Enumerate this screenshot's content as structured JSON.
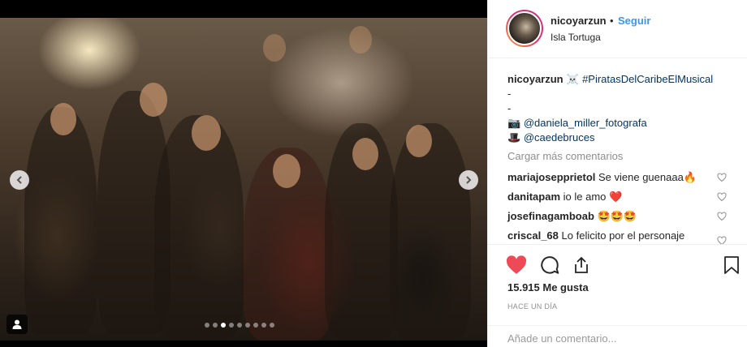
{
  "post": {
    "username": "nicoyarzun",
    "separator": "•",
    "follow_label": "Seguir",
    "location": "Isla Tortuga",
    "image_alt": "",
    "carousel_dots": 9,
    "carousel_active": 2
  },
  "caption": {
    "user": "nicoyarzun",
    "emoji": "☠️",
    "hashtag": "#PiratasDelCaribeElMusical",
    "dash1": "-",
    "dash2": "-",
    "camera_emoji": "📷",
    "mention1": "@daniela_miller_fotografa",
    "hat_emoji": "🎩",
    "mention2": "@caedebruces"
  },
  "load_more_label": "Cargar más comentarios",
  "comments": [
    {
      "user": "mariajosepprietol",
      "text": "Se viene guenaaa🔥"
    },
    {
      "user": "danitapam",
      "text": "io le amo ❤️"
    },
    {
      "user": "josefinagamboab",
      "text": "🤩🤩🤩"
    },
    {
      "user": "criscal_68",
      "text": "Lo felicito por el personaje"
    }
  ],
  "likes": "15.915 Me gusta",
  "time_ago": "HACE UN DÍA",
  "add_comment_placeholder": "Añade un comentario...",
  "colors": {
    "link_blue": "#3897f0",
    "hashtag_blue": "#003569",
    "like_red": "#ed4956",
    "muted_gray": "#8e8e8e"
  },
  "icons": {
    "like": "heart-icon",
    "comment": "comment-icon",
    "share": "share-icon",
    "save": "bookmark-icon",
    "prev": "chevron-left-icon",
    "next": "chevron-right-icon",
    "tag": "user-tag-icon"
  }
}
